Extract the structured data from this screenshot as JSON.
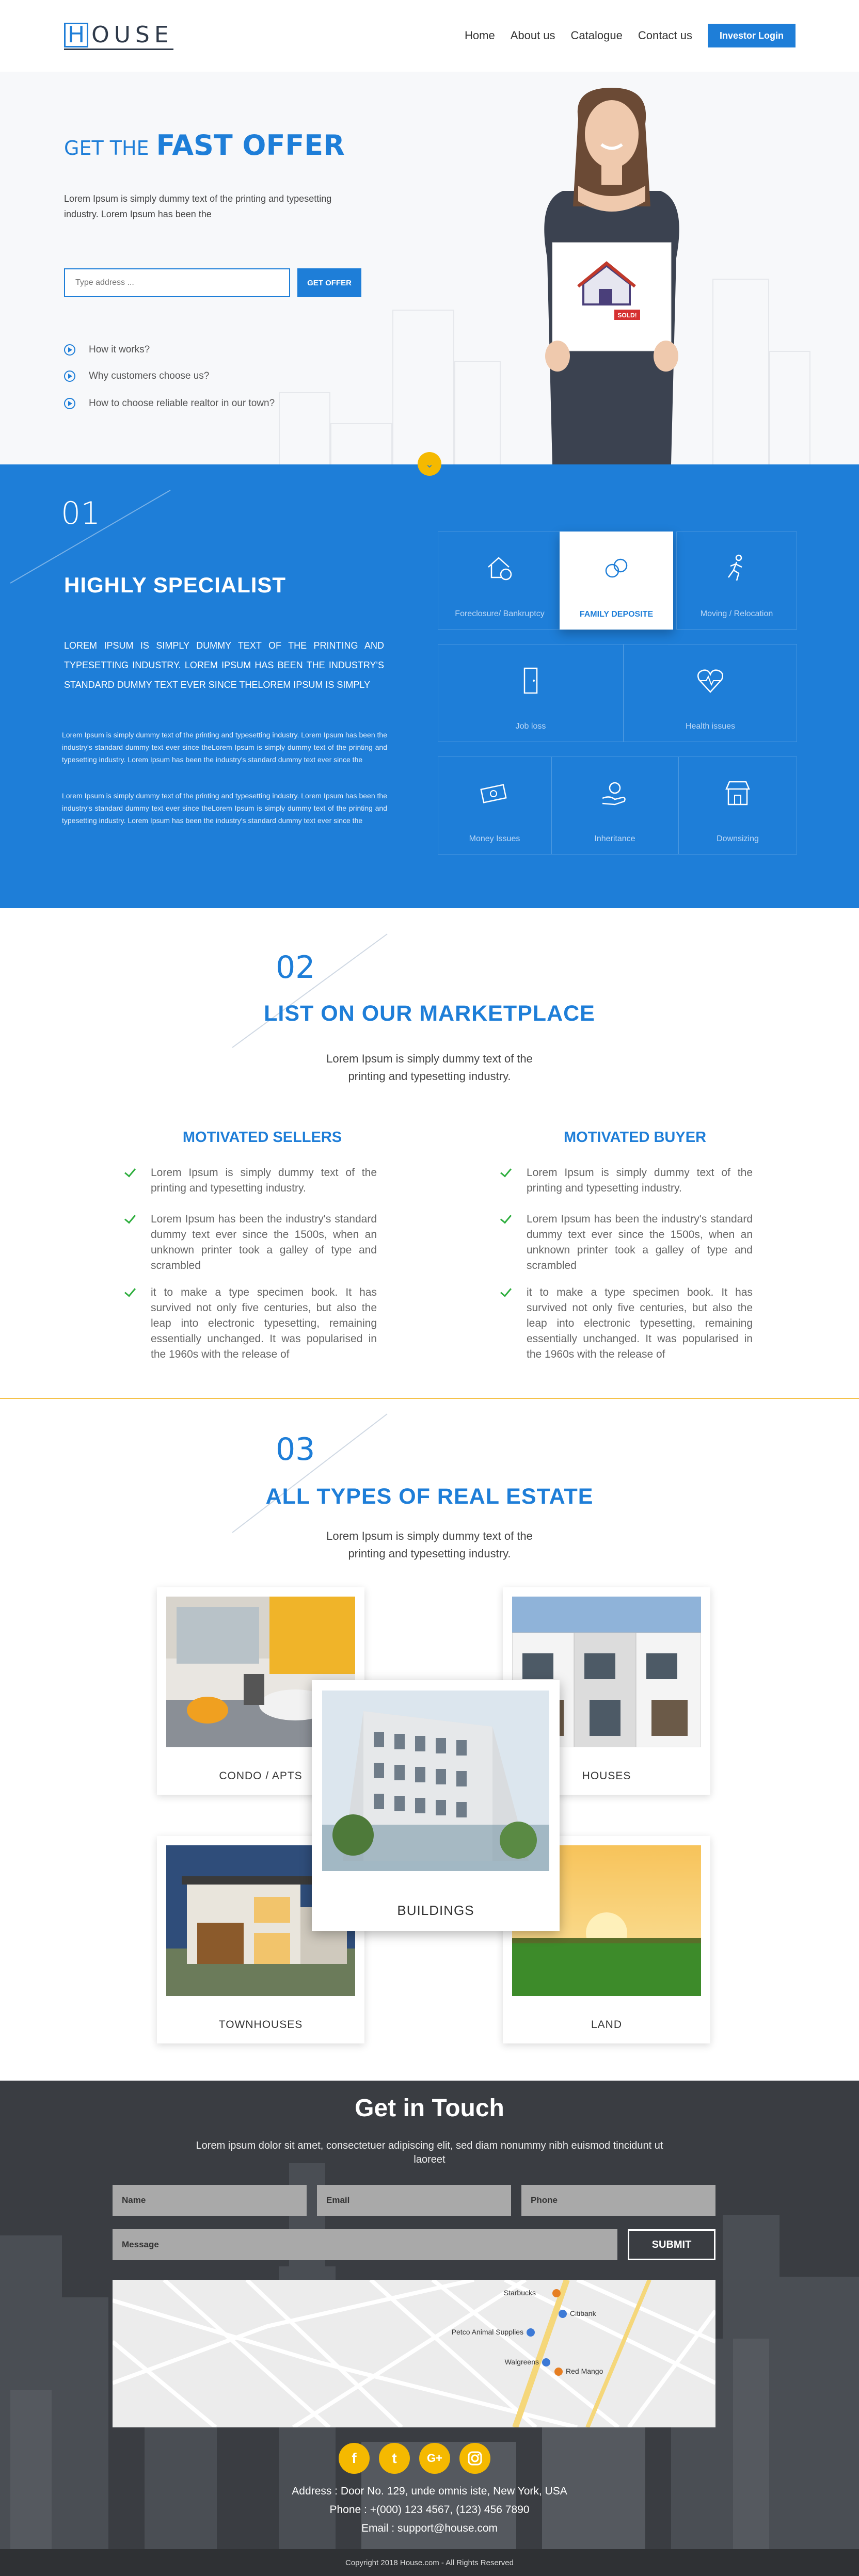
{
  "header": {
    "logo_letter": "H",
    "logo_rest": "OUSE",
    "nav": [
      "Home",
      "About us",
      "Catalogue",
      "Contact us"
    ],
    "investor_button": "Investor Login"
  },
  "hero": {
    "title_small": "GET THE",
    "title_big": "FAST OFFER",
    "text": "Lorem Ipsum is simply dummy text of the printing and typesetting industry. Lorem Ipsum has been the",
    "input_placeholder": "Type address ...",
    "button": "GET OFFER",
    "faqs": [
      "How it works?",
      "Why customers choose us?",
      "How to choose  reliable realtor in our town?"
    ],
    "sign_label": "SOLD!"
  },
  "services": {
    "number": "01",
    "title": "HIGHLY SPECIALIST",
    "upper_text": "LOREM IPSUM IS SIMPLY DUMMY TEXT OF THE PRINTING AND TYPESETTING INDUSTRY. LOREM IPSUM HAS BEEN THE INDUSTRY'S STANDARD DUMMY TEXT EVER SINCE THELOREM IPSUM IS SIMPLY",
    "paragraph1": "Lorem Ipsum is simply dummy text of the printing and typesetting industry. Lorem Ipsum has been the industry's standard dummy text ever since theLorem Ipsum is simply dummy text of the printing and typesetting industry. Lorem Ipsum has been the industry's standard dummy text ever since the",
    "paragraph2": "Lorem Ipsum is simply dummy text of the printing and typesetting industry. Lorem Ipsum has been the industry's standard dummy text ever since theLorem Ipsum is simply dummy text of the printing and typesetting industry. Lorem Ipsum has been the industry's standard dummy text ever since the",
    "items": [
      {
        "label": "Foreclosure/ Bankruptcy",
        "icon": "house-coin-icon"
      },
      {
        "label": "FAMILY DEPOSITE",
        "icon": "rings-icon"
      },
      {
        "label": "Moving / Relocation",
        "icon": "running-man-icon"
      },
      {
        "label": "Job loss",
        "icon": "door-icon"
      },
      {
        "label": "Health issues",
        "icon": "heartbeat-icon"
      },
      {
        "label": "Money Issues",
        "icon": "money-icon"
      },
      {
        "label": "Inheritance",
        "icon": "hand-coin-icon"
      },
      {
        "label": "Downsizing",
        "icon": "shop-icon"
      }
    ]
  },
  "marketplace": {
    "number": "02",
    "title": "LIST ON OUR MARKETPLACE",
    "subtitle_line1": "Lorem Ipsum is simply dummy text of the",
    "subtitle_line2": "printing and typesetting industry.",
    "sellers": {
      "title": "MOTIVATED SELLERS",
      "items": [
        "Lorem Ipsum is simply dummy text of the printing and typesetting industry.",
        "Lorem Ipsum has been the industry's standard dummy text ever since the 1500s, when an unknown printer took a galley of type and scrambled",
        "it to make a type specimen book. It has survived not only five centuries, but also the leap into electronic typesetting, remaining essentially unchanged. It was popularised in the 1960s with the release of"
      ]
    },
    "buyer": {
      "title": "MOTIVATED BUYER",
      "items": [
        "Lorem Ipsum is simply dummy text of the printing and typesetting industry.",
        "Lorem Ipsum has been the industry's standard dummy text ever since the 1500s, when an unknown printer took a galley of type and scrambled",
        "it to make a type specimen book. It has survived not only five centuries, but also the leap into electronic typesetting, remaining essentially unchanged. It was popularised in the 1960s with the release of"
      ]
    }
  },
  "real_estate": {
    "number": "03",
    "title": "ALL TYPES OF REAL ESTATE",
    "subtitle_line1": "Lorem Ipsum is simply dummy text of the",
    "subtitle_line2": "printing and typesetting industry.",
    "cards": [
      "CONDO / APTS",
      "HOUSES",
      "BUILDINGS",
      "TOWNHOUSES",
      "LAND"
    ]
  },
  "contact": {
    "title": "Get in Touch",
    "text": "Lorem ipsum dolor sit amet, consectetuer adipiscing elit, sed diam nonummy nibh euismod tincidunt ut laoreet",
    "fields": {
      "name": "Name",
      "email": "Email",
      "phone": "Phone",
      "message": "Message"
    },
    "submit": "SUBMIT",
    "map_labels": {
      "starbucks": "Starbucks",
      "citibank": "Citibank",
      "petco": "Petco Animal Supplies",
      "walgreens": "Walgreens",
      "red_mango": "Red Mango"
    },
    "social": [
      "f",
      "t",
      "G+",
      "instagram-icon"
    ],
    "address": "Address : Door No. 129, unde omnis iste, New York, USA",
    "phone": "Phone : +(000) 123 4567, (123) 456 7890",
    "email": "Email : support@house.com",
    "copyright": "Copyright 2018 House.com - All Rights Reserved"
  }
}
